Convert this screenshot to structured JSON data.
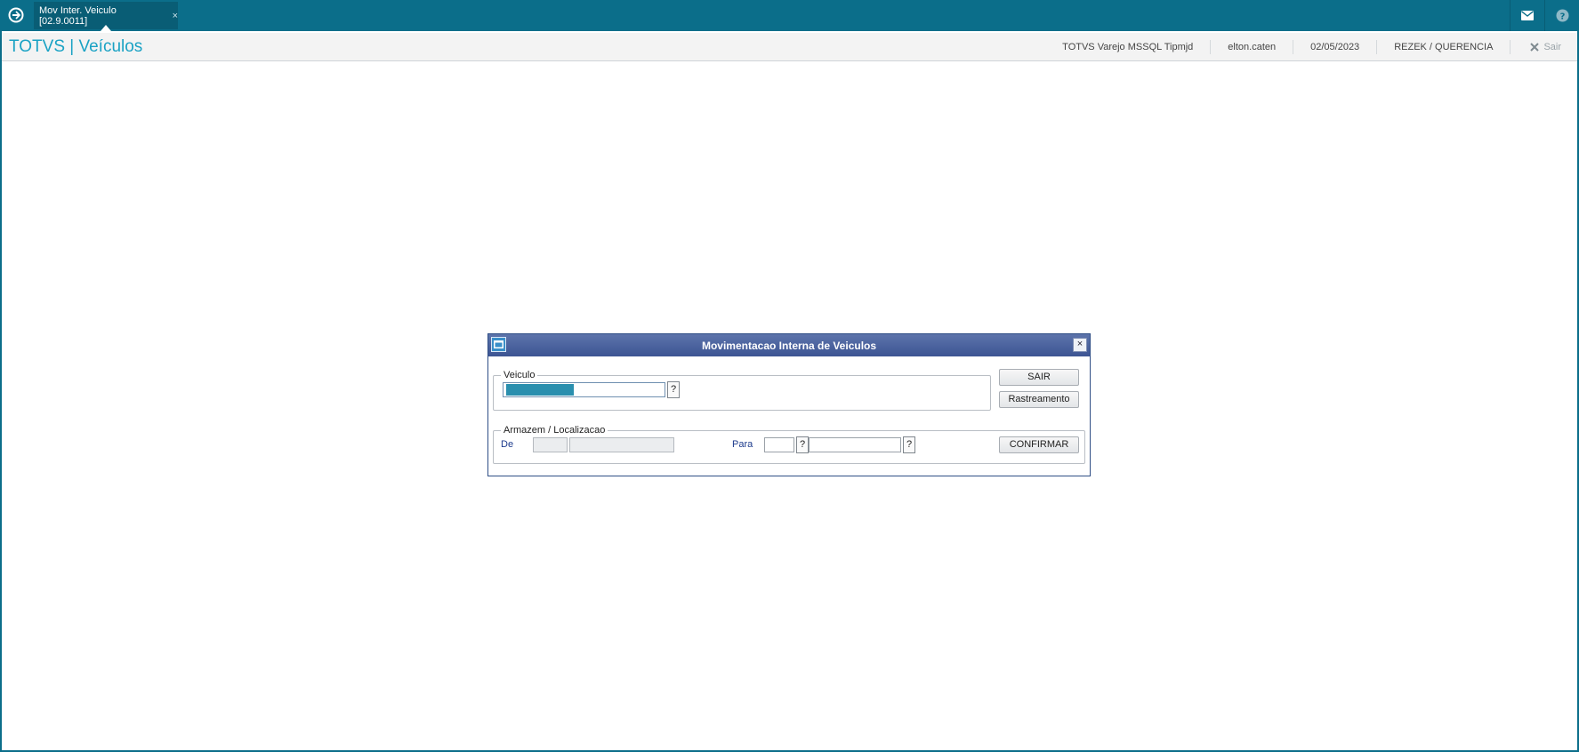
{
  "topbar": {
    "tab_label": "Mov Inter. Veiculo [02.9.0011]",
    "tab_close": "×",
    "icons": [
      "mail-icon",
      "help-icon"
    ]
  },
  "header": {
    "title": "TOTVS | Veículos",
    "environment": "TOTVS Varejo MSSQL Tipmjd",
    "user": "elton.caten",
    "date": "02/05/2023",
    "branch": "REZEK / QUERENCIA",
    "exit_label": "Sair"
  },
  "dialog": {
    "title": "Movimentacao Interna de Veiculos",
    "close_label": "×",
    "veiculo_group": {
      "legend": "Veiculo",
      "lookup_label": "?"
    },
    "armazem_group": {
      "legend": "Armazem / Localizacao",
      "de_label": "De",
      "para_label": "Para",
      "lookup_label": "?"
    },
    "buttons": {
      "sair": "SAIR",
      "rastreamento": "Rastreamento",
      "confirmar": "CONFIRMAR"
    }
  },
  "colors": {
    "brand": "#0b6e8a",
    "title_accent": "#1aa2c4",
    "dialog_title": "#3c5493"
  }
}
